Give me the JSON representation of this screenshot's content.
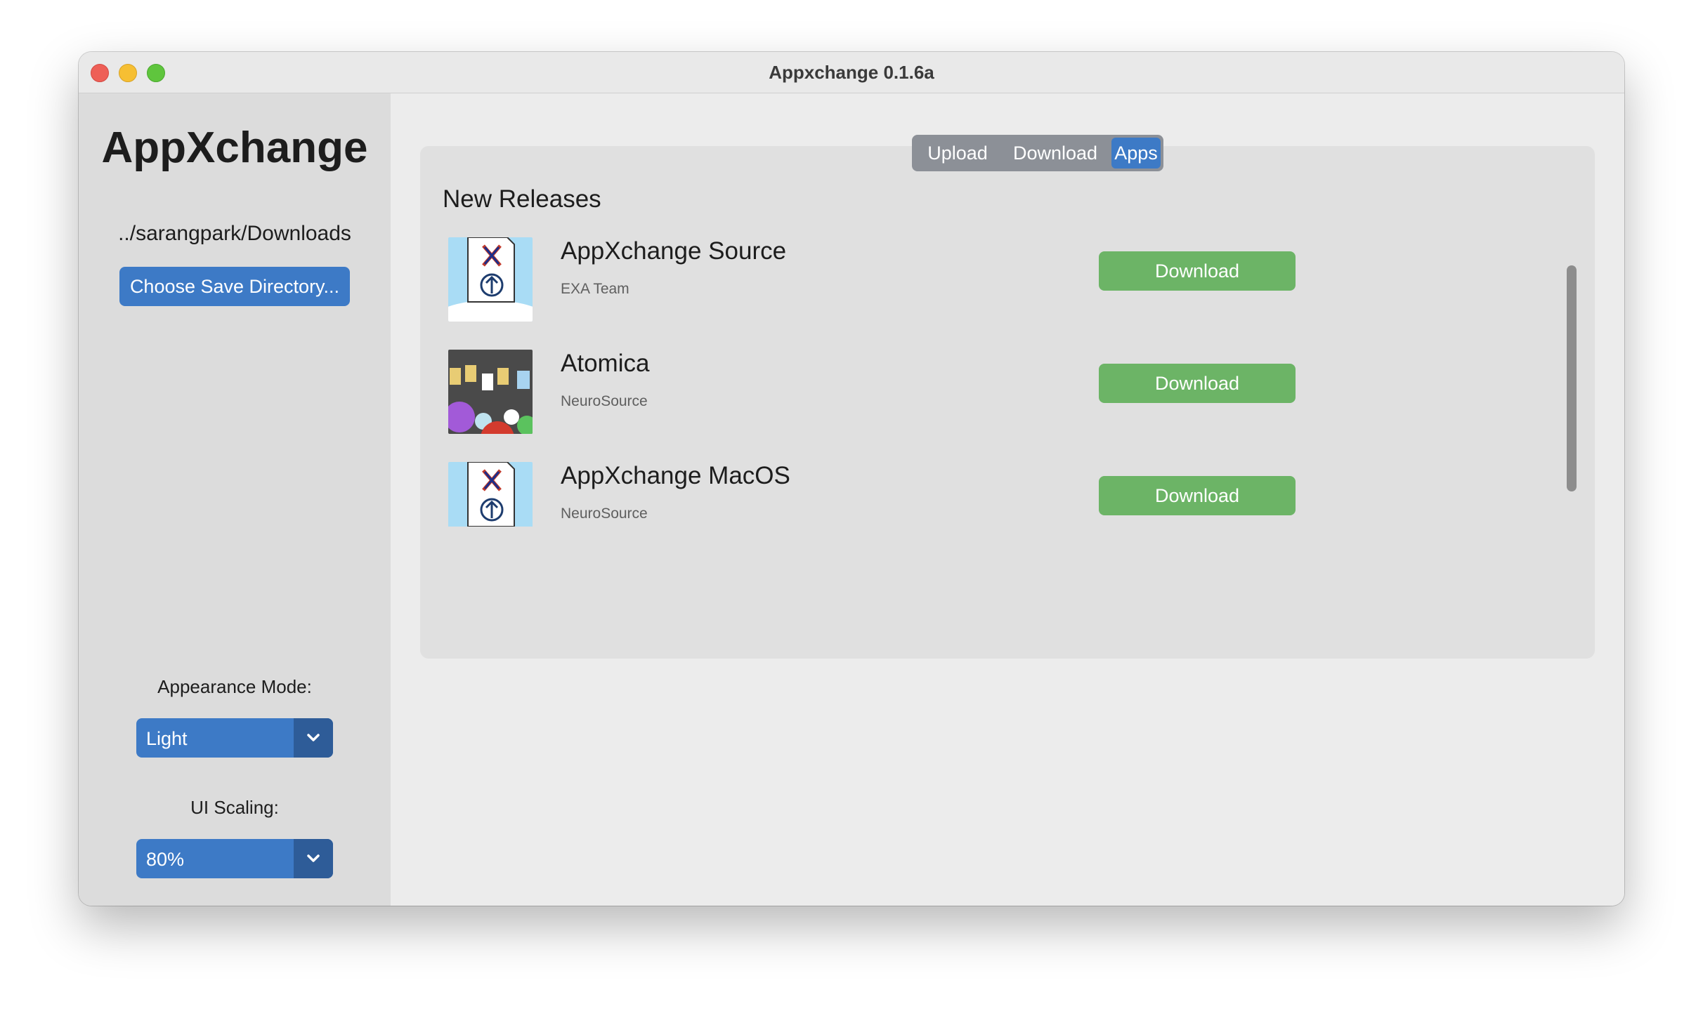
{
  "window": {
    "title": "Appxchange 0.1.6a"
  },
  "sidebar": {
    "app_name": "AppXchange",
    "save_path": "../sarangpark/Downloads",
    "choose_dir_label": "Choose Save Directory...",
    "appearance_label": "Appearance Mode:",
    "appearance_value": "Light",
    "scaling_label": "UI Scaling:",
    "scaling_value": "80%"
  },
  "main": {
    "tabs": [
      {
        "label": "Upload",
        "selected": false
      },
      {
        "label": "Download",
        "selected": false
      },
      {
        "label": "Apps",
        "selected": true
      }
    ],
    "section_title": "New Releases",
    "items": [
      {
        "title": "AppXchange Source",
        "author": "EXA Team",
        "button": "Download",
        "icon": "appxchange-icon"
      },
      {
        "title": "Atomica",
        "author": "NeuroSource",
        "button": "Download",
        "icon": "atomica-icon"
      },
      {
        "title": "AppXchange MacOS",
        "author": "NeuroSource",
        "button": "Download",
        "icon": "appxchange-icon"
      }
    ]
  },
  "colors": {
    "accent_blue": "#3d7ac6",
    "download_green": "#6cb466",
    "sidebar_bg": "#dcdcdc",
    "panel_bg": "#e0e0e0"
  }
}
